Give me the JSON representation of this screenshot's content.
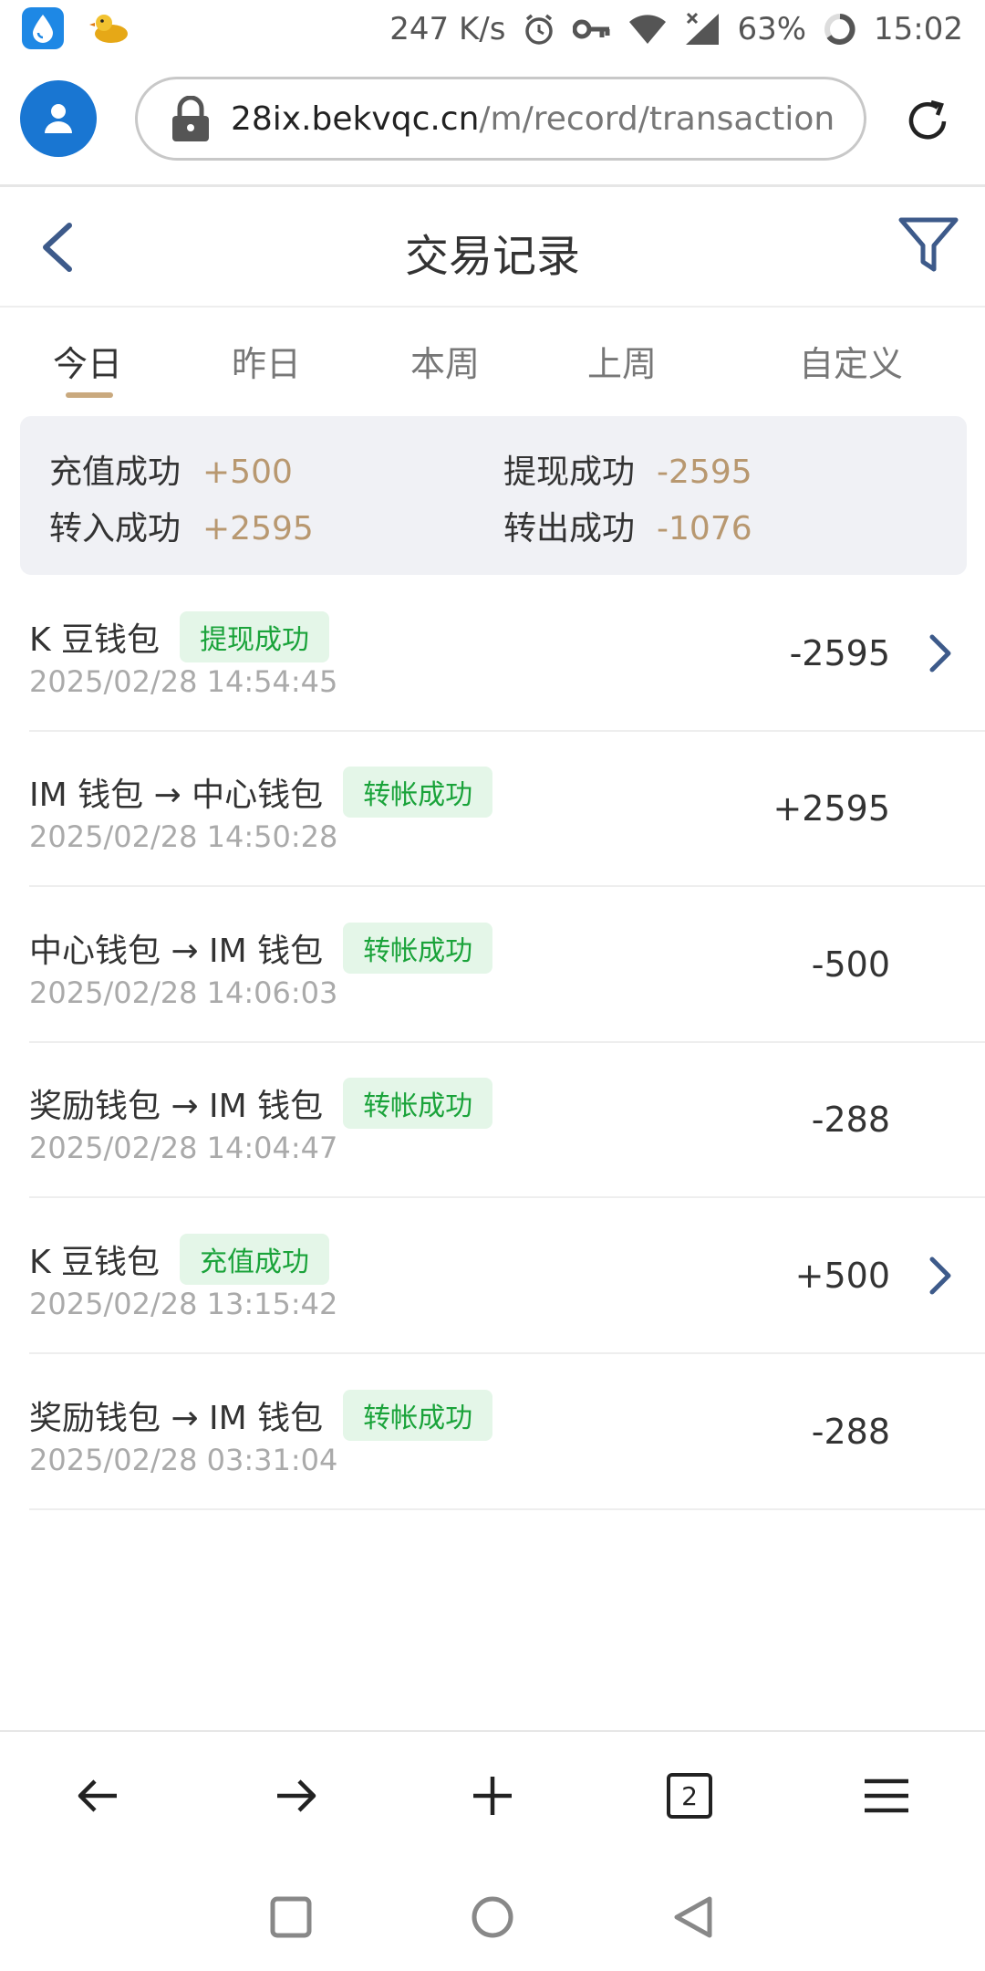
{
  "status_bar": {
    "speed": "247 K/s",
    "battery": "63%",
    "time": "15:02",
    "icons": [
      "drop-app-icon",
      "duck-app-icon",
      "alarm-icon",
      "key-icon",
      "wifi-icon",
      "signal-icon",
      "battery-icon"
    ]
  },
  "browser": {
    "url_domain": "28ix.bekvqc.cn",
    "url_path": "/m/record/transaction",
    "tab_count": "2"
  },
  "header": {
    "title": "交易记录"
  },
  "tabs": [
    {
      "label": "今日"
    },
    {
      "label": "昨日"
    },
    {
      "label": "本周"
    },
    {
      "label": "上周"
    },
    {
      "label": "自定义"
    }
  ],
  "summary": {
    "deposit_label": "充值成功",
    "deposit_value": "+500",
    "withdraw_label": "提现成功",
    "withdraw_value": "-2595",
    "transfer_in_label": "转入成功",
    "transfer_in_value": "+2595",
    "transfer_out_label": "转出成功",
    "transfer_out_value": "-1076"
  },
  "records": [
    {
      "title": "K 豆钱包",
      "status": "提现成功",
      "time": "2025/02/28 14:54:45",
      "amount": "-2595"
    },
    {
      "title": "IM 钱包 → 中心钱包",
      "status": "转帐成功",
      "time": "2025/02/28 14:50:28",
      "amount": "+2595"
    },
    {
      "title": "中心钱包 → IM 钱包",
      "status": "转帐成功",
      "time": "2025/02/28 14:06:03",
      "amount": "-500"
    },
    {
      "title": "奖励钱包 → IM 钱包",
      "status": "转帐成功",
      "time": "2025/02/28 14:04:47",
      "amount": "-288"
    },
    {
      "title": "K 豆钱包",
      "status": "充值成功",
      "time": "2025/02/28 13:15:42",
      "amount": "+500"
    },
    {
      "title": "奖励钱包 → IM 钱包",
      "status": "转帐成功",
      "time": "2025/02/28 03:31:04",
      "amount": "-288"
    }
  ],
  "colors": {
    "accent": "#3d5a8a",
    "summary_value": "#b89870",
    "badge_text": "#1aa33a",
    "badge_bg": "#e4f6e8",
    "tab_underline": "#c9a97e"
  }
}
